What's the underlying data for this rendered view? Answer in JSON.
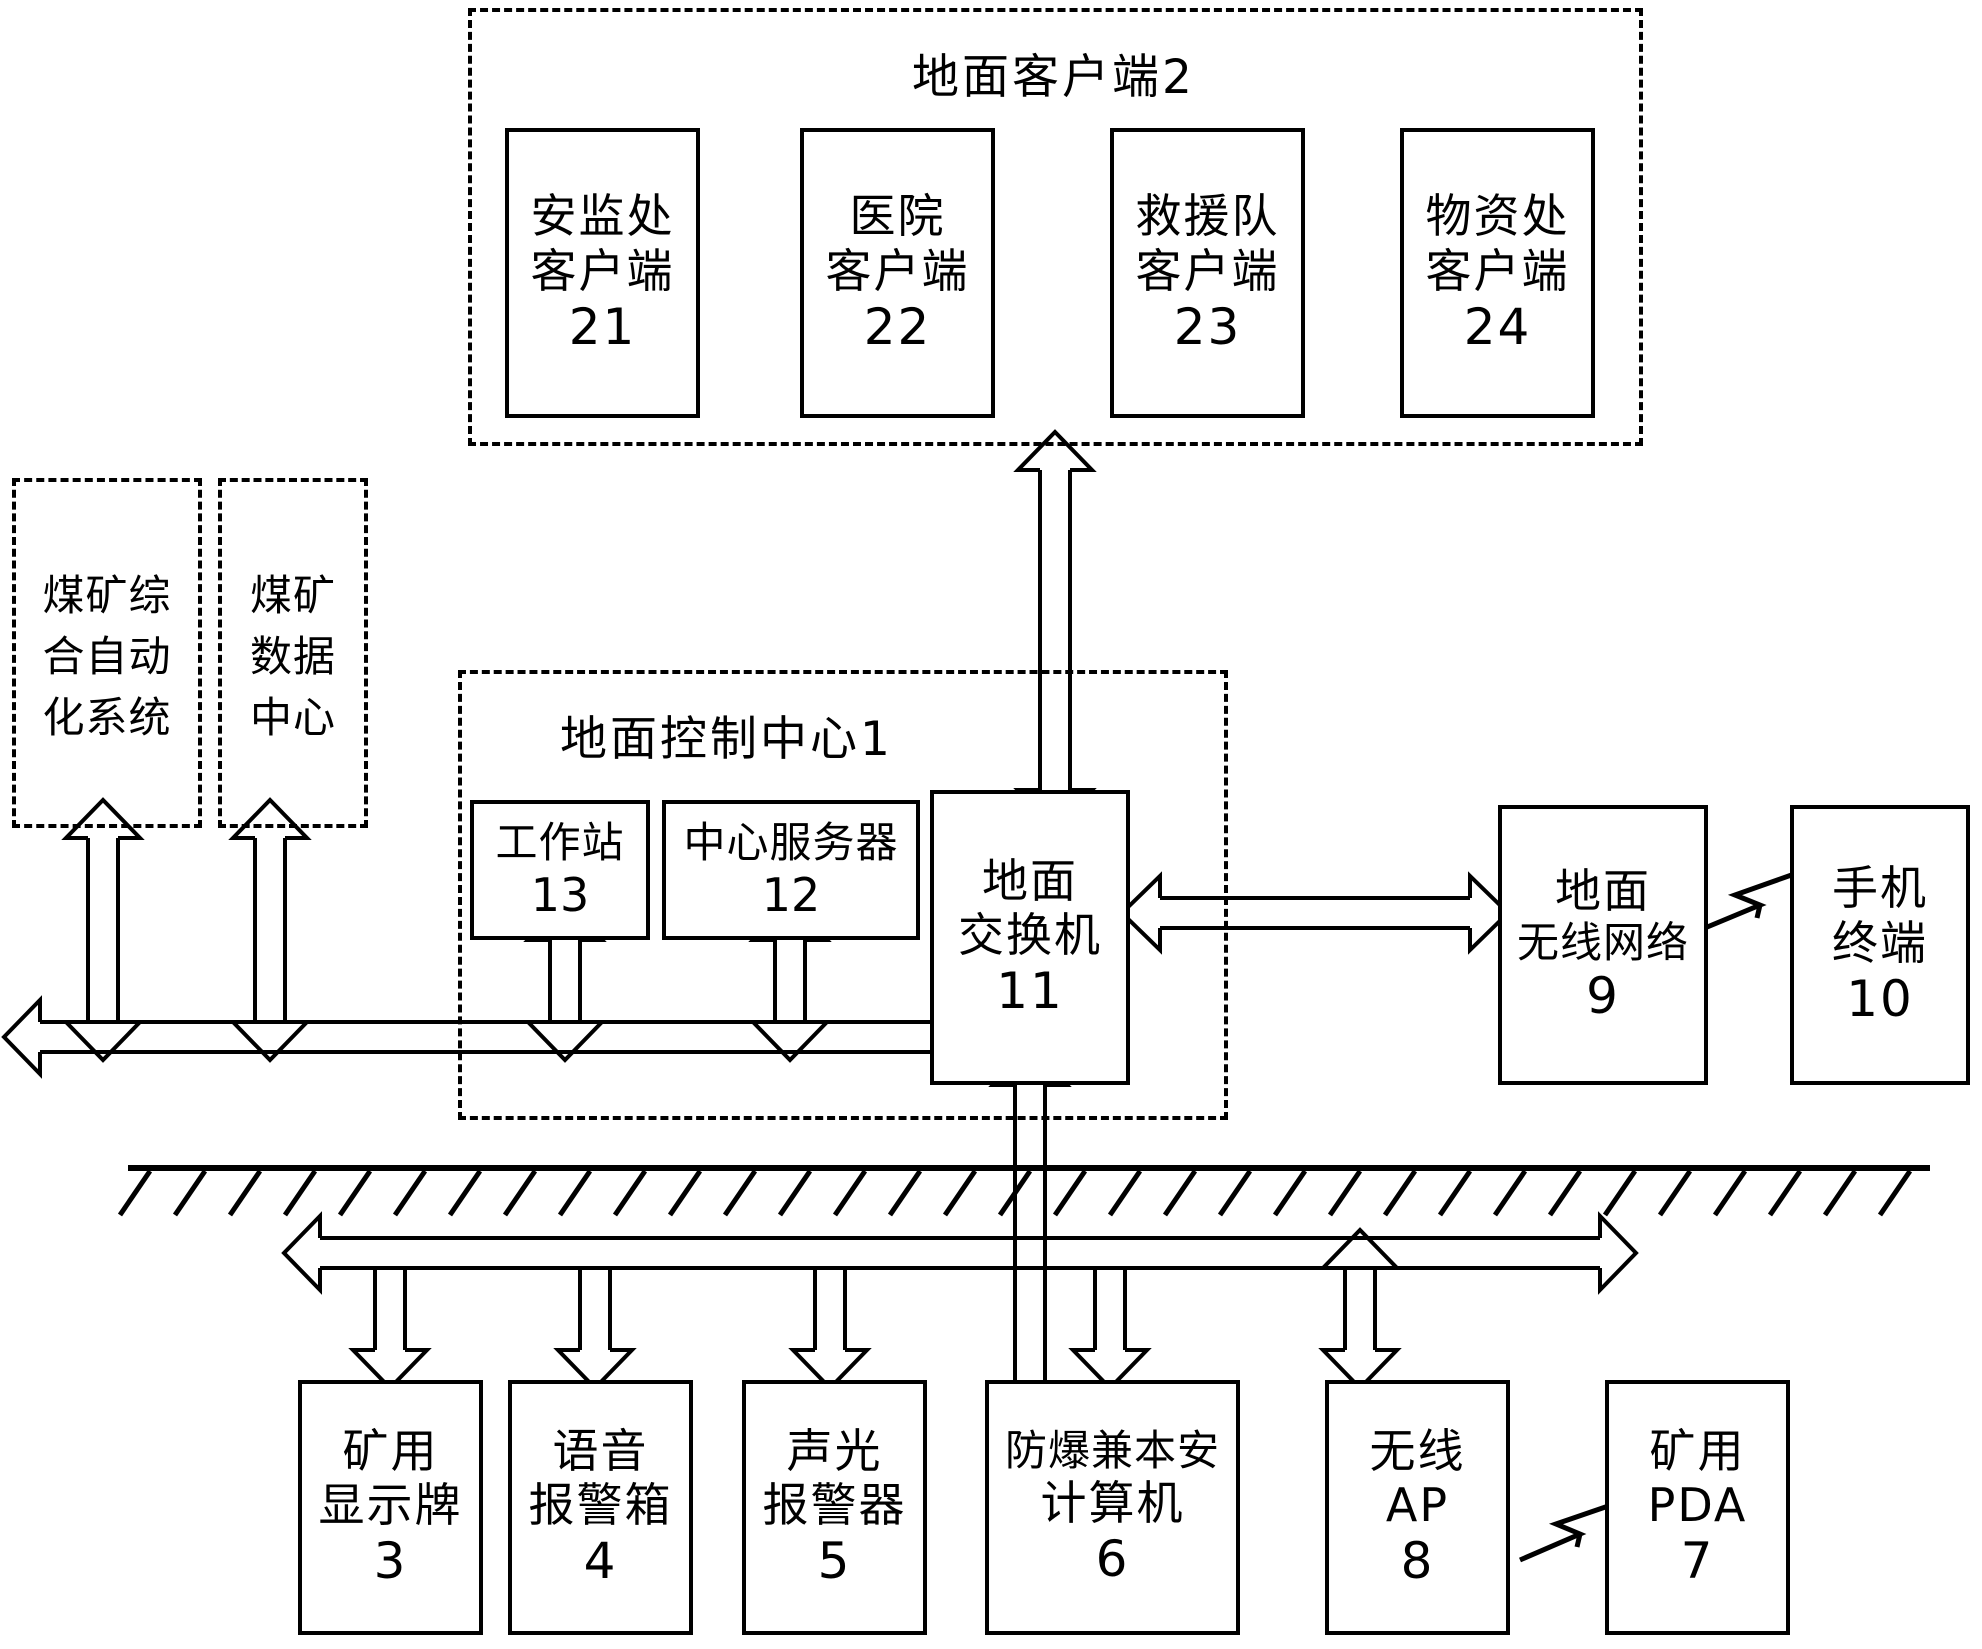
{
  "diagram": {
    "title": "Coal mine emergency communication system block diagram",
    "ground_label": "ground-surface-hatching"
  },
  "surface_clients_group": {
    "label": "地面客户端2",
    "clients": [
      {
        "line1": "安监处",
        "line2": "客户端",
        "num": "21"
      },
      {
        "line1": "医院",
        "line2": "客户端",
        "num": "22"
      },
      {
        "line1": "救援队",
        "line2": "客户端",
        "num": "23"
      },
      {
        "line1": "物资处",
        "line2": "客户端",
        "num": "24"
      }
    ]
  },
  "external_systems": [
    {
      "line1": "煤矿综",
      "line2": "合自动",
      "line3": "化系统"
    },
    {
      "line1": "煤矿",
      "line2": "数据",
      "line3": "中心"
    }
  ],
  "control_center": {
    "label": "地面控制中心1",
    "nodes": [
      {
        "line1": "工作站",
        "line2": "",
        "num": "13"
      },
      {
        "line1": "中心服务器",
        "line2": "",
        "num": "12"
      }
    ],
    "switch": {
      "line1": "地面",
      "line2": "交换机",
      "num": "11"
    }
  },
  "surface_wireless": [
    {
      "line1": "地面",
      "line2": "无线网络",
      "num": "9"
    },
    {
      "line1": "手机",
      "line2": "终端",
      "num": "10"
    }
  ],
  "underground_devices": [
    {
      "line1": "矿用",
      "line2": "显示牌",
      "num": "3"
    },
    {
      "line1": "语音",
      "line2": "报警箱",
      "num": "4"
    },
    {
      "line1": "声光",
      "line2": "报警器",
      "num": "5"
    },
    {
      "line1": "防爆兼本安",
      "line2": "计算机",
      "num": "6"
    },
    {
      "line1": "无线",
      "line2": "AP",
      "num": "8"
    },
    {
      "line1": "矿用",
      "line2": "PDA",
      "num": "7"
    }
  ],
  "colors": {
    "stroke": "#000000",
    "background": "#ffffff"
  }
}
